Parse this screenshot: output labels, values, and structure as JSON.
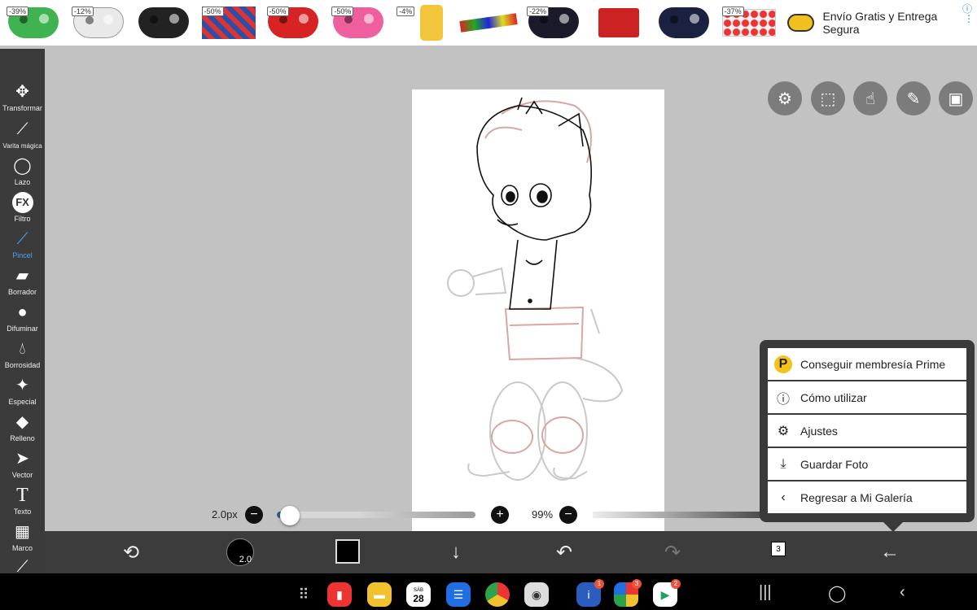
{
  "ad": {
    "discounts": [
      "-39%",
      "-12%",
      "",
      "-50%",
      "-50%",
      "-50%",
      "-4%",
      "",
      "-22%",
      "",
      "",
      "-37%"
    ],
    "brand_text": "Envío Gratis y Entrega Segura",
    "info_icon": "info-icon",
    "more_icon": "more-vert-icon"
  },
  "tools": [
    {
      "label": "Transformar",
      "icon": "move-icon"
    },
    {
      "label": "Varita mágica",
      "icon": "magic-wand-icon"
    },
    {
      "label": "Lazo",
      "icon": "lasso-icon"
    },
    {
      "label": "Filtro",
      "icon": "fx-icon",
      "glyph": "FX"
    },
    {
      "label": "Pincel",
      "icon": "brush-icon"
    },
    {
      "label": "Borrador",
      "icon": "eraser-icon"
    },
    {
      "label": "Difuminar",
      "icon": "smudge-icon"
    },
    {
      "label": "Borrosidad",
      "icon": "blur-icon"
    },
    {
      "label": "Especial",
      "icon": "sparkle-icon"
    },
    {
      "label": "Relleno",
      "icon": "fill-icon"
    },
    {
      "label": "Vector",
      "icon": "cursor-icon"
    },
    {
      "label": "Texto",
      "icon": "text-icon",
      "glyph": "T"
    },
    {
      "label": "Marco",
      "icon": "frame-icon"
    }
  ],
  "brush_size": "2.0px",
  "brush_size_value": 2.0,
  "brush_badge": "2.0",
  "opacity": "99%",
  "layers_count": "3",
  "active_color": "#000000",
  "menu": [
    {
      "label": "Conseguir membresía Prime",
      "icon": "prime-icon"
    },
    {
      "label": "Cómo utilizar",
      "icon": "help-icon"
    },
    {
      "label": "Ajustes",
      "icon": "gear-icon"
    },
    {
      "label": "Guardar Foto",
      "icon": "download-icon"
    },
    {
      "label": "Regresar a Mi Galería",
      "icon": "chevron-left-icon"
    }
  ],
  "system": {
    "calendar_day": "28",
    "calendar_weekday": "SÁB",
    "badges": [
      "1",
      "3",
      "2"
    ]
  }
}
